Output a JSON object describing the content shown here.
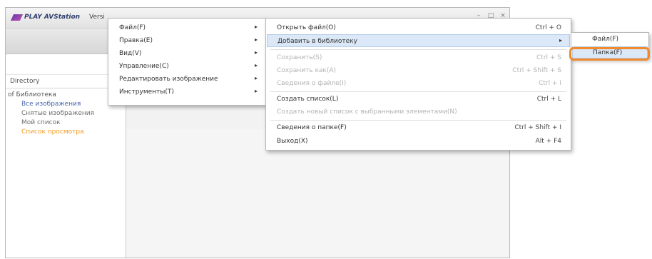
{
  "app": {
    "title": "PLAY AVStation",
    "title_tail": "Versi"
  },
  "sidebar": {
    "header": "Directory",
    "tree_root": "of Библиотека",
    "items": [
      {
        "label": "Все изображения"
      },
      {
        "label": "Снятые изображения"
      },
      {
        "label": "Мой список"
      },
      {
        "label": "Список просмотра"
      }
    ]
  },
  "main_menu": {
    "items": [
      {
        "label": "Файл(F)"
      },
      {
        "label": "Правка(E)"
      },
      {
        "label": "Вид(V)"
      },
      {
        "label": "Управление(C)"
      },
      {
        "label": "Редактировать изображение"
      },
      {
        "label": "Инструменты(T)"
      }
    ]
  },
  "file_menu": {
    "items": [
      {
        "label": "Открыть файл(O)",
        "shortcut": "Ctrl + O"
      },
      {
        "label": "Добавить в библиотеку",
        "shortcut": ""
      },
      {
        "label": "Сохранить(S)",
        "shortcut": "Ctrl + S"
      },
      {
        "label": "Сохранить как(A)",
        "shortcut": "Ctrl + Shift + S"
      },
      {
        "label": "Сведения о файле(I)",
        "shortcut": "Ctrl + I"
      },
      {
        "label": "Создать список(L)",
        "shortcut": "Ctrl + L"
      },
      {
        "label": "Создать новый список с выбранными элементами(N)",
        "shortcut": ""
      },
      {
        "label": "Сведения о папке(F)",
        "shortcut": "Ctrl + Shift + I"
      },
      {
        "label": "Выход(X)",
        "shortcut": "Alt + F4"
      }
    ]
  },
  "library_submenu": {
    "items": [
      {
        "label": "Файл(F)"
      },
      {
        "label": "Папка(F)"
      }
    ]
  },
  "colors": {
    "callout": "#f08a2c",
    "hover": "#dbe8f7"
  }
}
